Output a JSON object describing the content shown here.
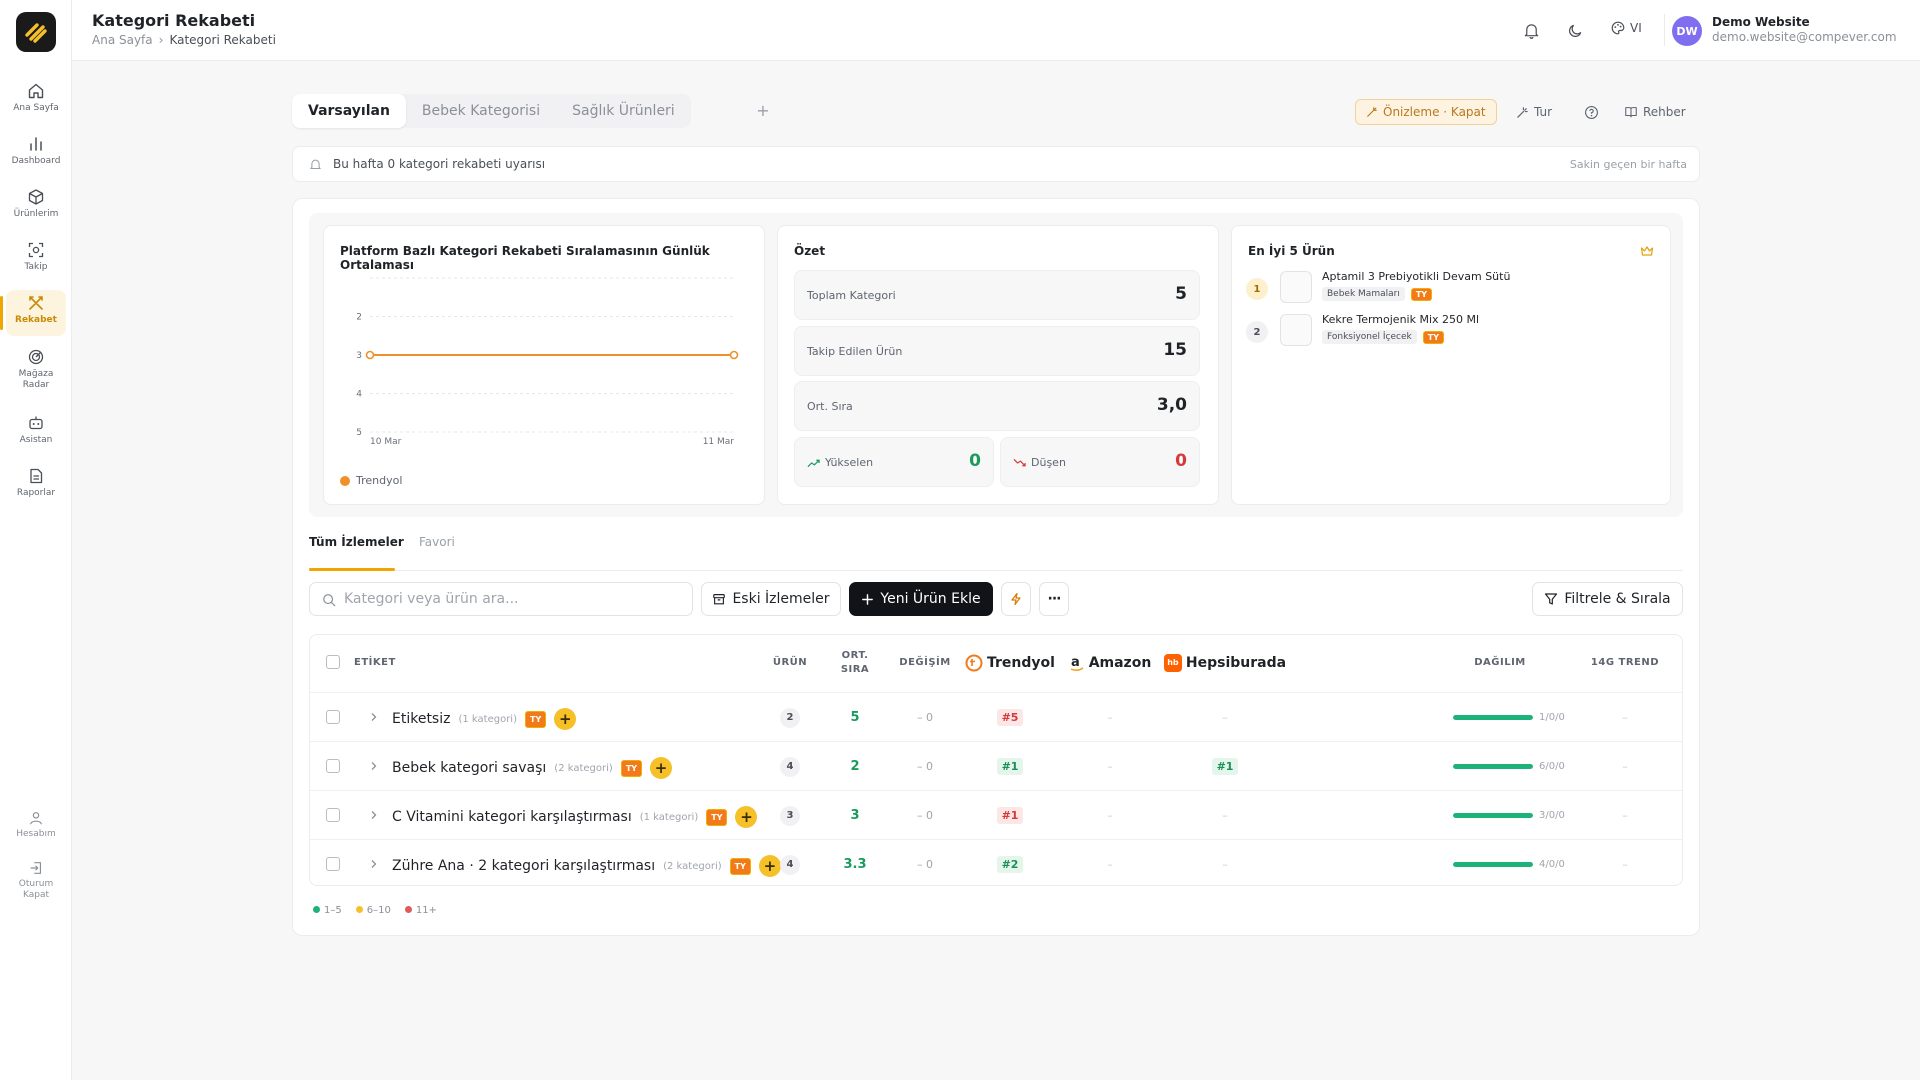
{
  "sidebar": {
    "items": [
      {
        "label": "Ana Sayfa",
        "icon": "home-icon"
      },
      {
        "label": "Dashboard",
        "icon": "bar-chart-icon"
      },
      {
        "label": "Ürünlerim",
        "icon": "box-icon"
      },
      {
        "label": "Takip",
        "icon": "scan-icon"
      },
      {
        "label": "Rekabet",
        "icon": "crossed-swords-icon",
        "active": true
      },
      {
        "label": "Mağaza Radar",
        "icon": "radar-icon"
      },
      {
        "label": "Asistan",
        "icon": "bot-icon"
      },
      {
        "label": "Raporlar",
        "icon": "report-icon"
      }
    ],
    "bottom": [
      {
        "label": "Hesabım",
        "icon": "user-icon"
      },
      {
        "label": "Oturum Kapat",
        "icon": "logout-icon"
      }
    ]
  },
  "header": {
    "title": "Kategori Rekabeti",
    "breadcrumb": [
      "Ana Sayfa",
      "›",
      "Kategori Rekabeti"
    ],
    "lang": "VI",
    "user": {
      "initials": "DW",
      "name": "Demo Website",
      "email": "demo.website@compever.com"
    }
  },
  "tabs": [
    {
      "label": "Varsayılan",
      "active": true
    },
    {
      "label": "Bebek Kategorisi"
    },
    {
      "label": "Sağlık Ürünleri"
    }
  ],
  "tab_add": "+",
  "actions": {
    "preview": "Önizleme · Kapat",
    "tour": "Tur",
    "guide": "Rehber"
  },
  "alert": {
    "text": "Bu hafta 0 kategori rekabeti uyarısı",
    "sub": "Sakin geçen bir hafta"
  },
  "chart_card": {
    "title": "Platform Bazlı Kategori Rekabeti Sıralamasının Günlük Ortalaması",
    "legend": "Trendyol"
  },
  "chart_data": {
    "type": "line",
    "title": "Platform Bazlı Kategori Rekabeti Sıralamasının Günlük Ortalaması",
    "x": [
      "10 Mar",
      "11 Mar"
    ],
    "series": [
      {
        "name": "Trendyol",
        "values": [
          3,
          3
        ],
        "color": "#f0902a"
      }
    ],
    "y_ticks": [
      2,
      3,
      4,
      5
    ],
    "ylim": [
      1,
      5
    ],
    "y_inverted": true,
    "grid": true,
    "legend_position": "bottom-left"
  },
  "summary": {
    "title": "Özet",
    "total_label": "Toplam Kategori",
    "total": "5",
    "tracked_label": "Takip Edilen Ürün",
    "tracked": "15",
    "avg_label": "Ort. Sıra",
    "avg": "3,0",
    "up_label": "Yükselen",
    "up": "0",
    "down_label": "Düşen",
    "down": "0"
  },
  "top5": {
    "title": "En İyi 5 Ürün",
    "items": [
      {
        "rank": "1",
        "name": "Aptamil 3 Prebiyotikli Devam Sütü",
        "category": "Bebek Mamaları",
        "tag": "TY"
      },
      {
        "rank": "2",
        "name": "Kekre Termojenik Mix 250 Ml",
        "category": "Fonksiyonel İçecek",
        "tag": "TY"
      }
    ]
  },
  "subtabs": {
    "all": "Tüm İzlemeler",
    "fav": "Favori"
  },
  "toolbar": {
    "search_placeholder": "Kategori veya ürün ara...",
    "old": "Eski İzlemeler",
    "new": "Yeni Ürün Ekle",
    "filter": "Filtrele & Sırala",
    "more": "···"
  },
  "table": {
    "headers": {
      "label": "ETİKET",
      "product": "ÜRÜN",
      "avg1": "ORT.",
      "avg2": "SIRA",
      "change": "DEĞİŞİM",
      "trendyol": "Trendyol",
      "amazon": "Amazon",
      "hepsiburada": "Hepsiburada",
      "dist": "DAĞILIM",
      "trend": "14G TREND"
    },
    "rows": [
      {
        "name": "Etiketsiz",
        "count": "(1 kategori)",
        "tag": "TY",
        "products": "2",
        "avg": "5",
        "change": "– 0",
        "trendyol": "#5",
        "trendyol_status": "r",
        "amazon": "–",
        "hepsiburada": "–",
        "dist": "1/0/0",
        "dist_fill": 1.0,
        "trend": "–"
      },
      {
        "name": "Bebek kategori savaşı",
        "count": "(2 kategori)",
        "tag": "TY",
        "products": "4",
        "avg": "2",
        "change": "– 0",
        "trendyol": "#1",
        "trendyol_status": "g",
        "amazon": "–",
        "hepsiburada": "#1",
        "dist": "6/0/0",
        "dist_fill": 1.0,
        "trend": "–"
      },
      {
        "name": "C Vitamini kategori karşılaştırması",
        "count": "(1 kategori)",
        "tag": "TY",
        "products": "3",
        "avg": "3",
        "change": "– 0",
        "trendyol": "#1",
        "trendyol_status": "r",
        "amazon": "–",
        "hepsiburada": "–",
        "dist": "3/0/0",
        "dist_fill": 1.0,
        "trend": "–"
      },
      {
        "name": "Zühre Ana · 2 kategori karşılaştırması",
        "count": "(2 kategori)",
        "tag": "TY",
        "products": "4",
        "avg": "3.3",
        "change": "– 0",
        "trendyol": "#2",
        "trendyol_status": "g",
        "amazon": "–",
        "hepsiburada": "–",
        "dist": "4/0/0",
        "dist_fill": 1.0,
        "trend": "–"
      }
    ]
  },
  "legend": [
    {
      "label": "1–5",
      "color": "#1cb27a"
    },
    {
      "label": "6–10",
      "color": "#f5c028"
    },
    {
      "label": "11+",
      "color": "#e05a5a"
    }
  ],
  "colors": {
    "accent": "#f0a500",
    "primary_dark": "#111318",
    "success": "#1a9b5c",
    "danger": "#d33b3b"
  }
}
